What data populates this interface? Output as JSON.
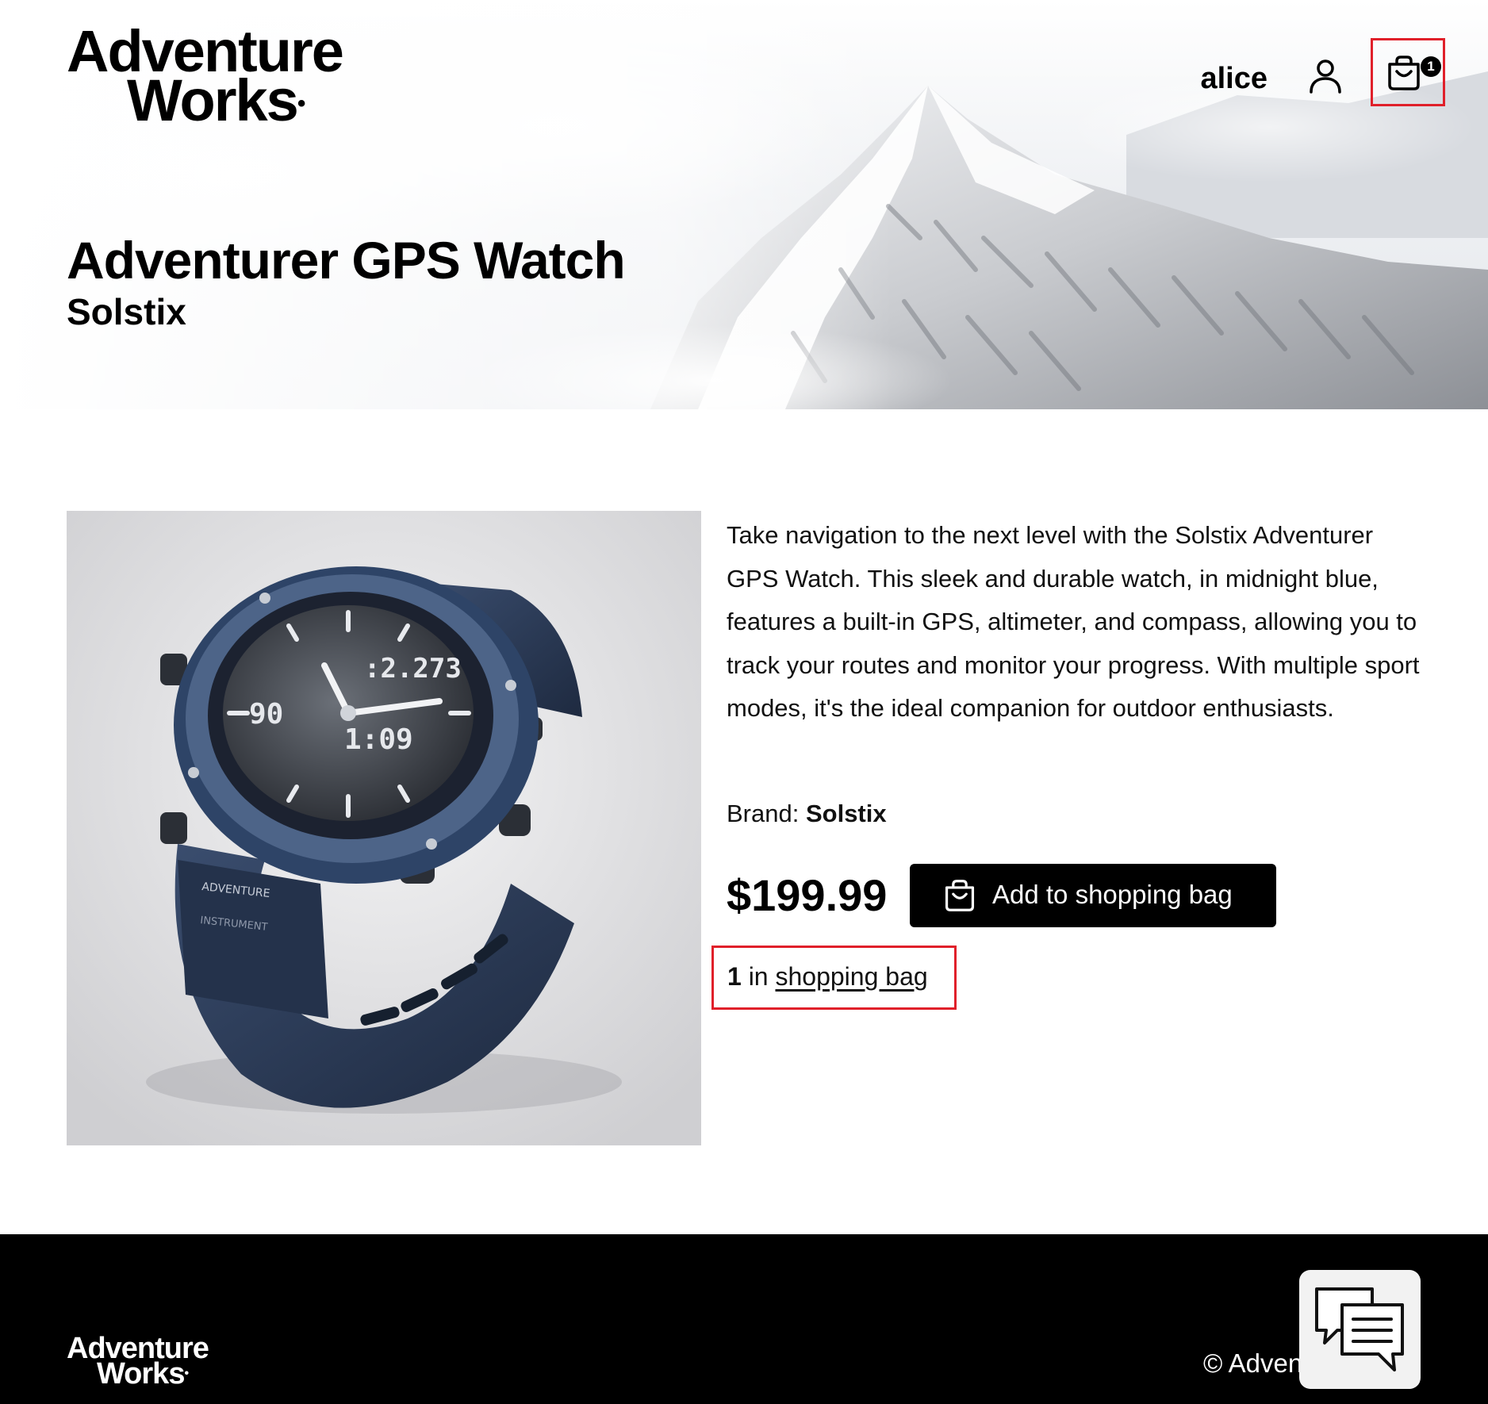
{
  "header": {
    "logo_line1": "Adventure",
    "logo_line2": "Works",
    "username": "alice",
    "cart_count": "1"
  },
  "hero": {
    "title": "Adventurer GPS Watch",
    "brand": "Solstix"
  },
  "product": {
    "description": "Take navigation to the next level with the Solstix Adventurer GPS Watch. This sleek and durable watch, in midnight blue, features a built-in GPS, altimeter, and compass, allowing you to track your routes and monitor your progress. With multiple sport modes, it's the ideal companion for outdoor enthusiasts.",
    "brand_label": "Brand:",
    "brand_value": "Solstix",
    "price": "$199.99",
    "add_button_label": "Add to shopping bag",
    "in_bag_count": "1",
    "in_bag_text": "in",
    "in_bag_link": "shopping bag",
    "image_alt": "Adventurer GPS Watch",
    "watch_readout_top": ":2.273",
    "watch_readout_left": "90",
    "watch_readout_mid": "1:09",
    "watch_band_text1": "ADVENTURE",
    "watch_band_text2": "INSTRUMENT"
  },
  "footer": {
    "logo_line1": "Adventure",
    "logo_line2": "Works",
    "copyright": "© AdventureWorks"
  },
  "colors": {
    "highlight": "#e0202a",
    "button_bg": "#000000",
    "footer_bg": "#000000",
    "watch_blue": "#2c3e5c"
  },
  "icons": [
    "user-icon",
    "shopping-bag-icon",
    "chat-icon"
  ]
}
